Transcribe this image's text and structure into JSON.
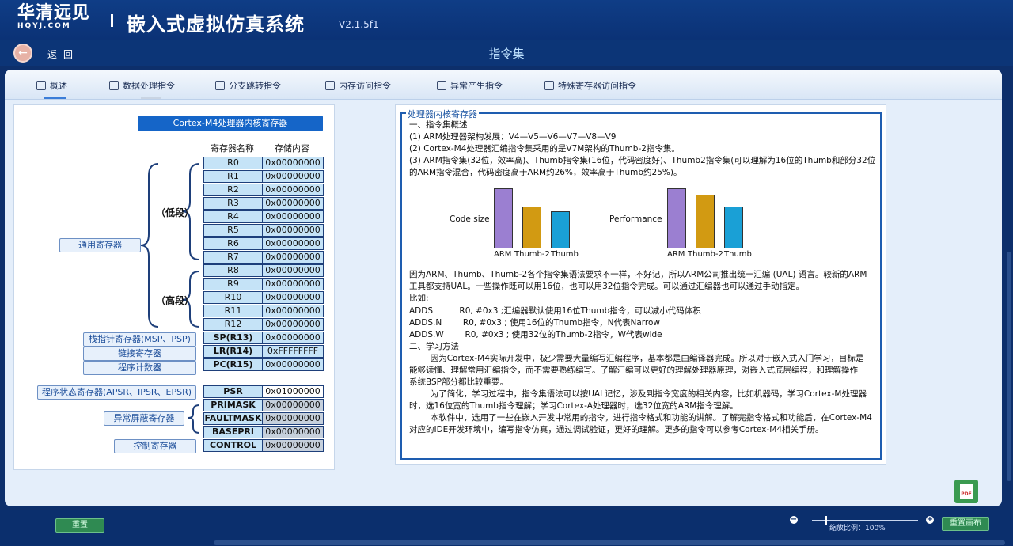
{
  "header": {
    "logo_cn": "华清远见",
    "logo_en": "HQYJ.COM",
    "system_title": "嵌入式虚拟仿真系统",
    "version": "V2.1.5f1"
  },
  "nav": {
    "back_icon": "←",
    "back_label": "返回",
    "page_title": "指令集"
  },
  "tabs": [
    {
      "label": "概述",
      "icon": "document-icon"
    },
    {
      "label": "数据处理指令",
      "icon": "pulse-icon"
    },
    {
      "label": "分支跳转指令",
      "icon": "edit-icon"
    },
    {
      "label": "内存访问指令",
      "icon": "save-icon"
    },
    {
      "label": "异常产生指令",
      "icon": "warning-icon"
    },
    {
      "label": "特殊寄存器访问指令",
      "icon": "server-icon"
    }
  ],
  "diagram": {
    "title": "Cortex-M4处理器内核寄存器",
    "col_name": "寄存器名称",
    "col_value": "存储内容",
    "low_label": "（低段）",
    "high_label": "（高段）",
    "categories": {
      "general": "通用寄存器",
      "sp": "栈指针寄存器(MSP、PSP)",
      "lr": "链接寄存器",
      "pc": "程序计数器",
      "psr": "程序状态寄存器(APSR、IPSR、EPSR)",
      "mask": "异常屏蔽寄存器",
      "control": "控制寄存器"
    },
    "registers": [
      {
        "name": "R0",
        "value": "0x00000000"
      },
      {
        "name": "R1",
        "value": "0x00000000"
      },
      {
        "name": "R2",
        "value": "0x00000000"
      },
      {
        "name": "R3",
        "value": "0x00000000"
      },
      {
        "name": "R4",
        "value": "0x00000000"
      },
      {
        "name": "R5",
        "value": "0x00000000"
      },
      {
        "name": "R6",
        "value": "0x00000000"
      },
      {
        "name": "R7",
        "value": "0x00000000"
      },
      {
        "name": "R8",
        "value": "0x00000000"
      },
      {
        "name": "R9",
        "value": "0x00000000"
      },
      {
        "name": "R10",
        "value": "0x00000000"
      },
      {
        "name": "R11",
        "value": "0x00000000"
      },
      {
        "name": "R12",
        "value": "0x00000000"
      },
      {
        "name": "SP(R13)",
        "value": "0x00000000"
      },
      {
        "name": "LR(R14)",
        "value": "0xFFFFFFFF"
      },
      {
        "name": "PC(R15)",
        "value": "0x00000000"
      }
    ],
    "special": [
      {
        "name": "PSR",
        "value": "0x01000000"
      },
      {
        "name": "PRIMASK",
        "value": "0x00000000"
      },
      {
        "name": "FAULTMASK",
        "value": "0x00000000"
      },
      {
        "name": "BASEPRI",
        "value": "0x00000000"
      },
      {
        "name": "CONTROL",
        "value": "0x00000000"
      }
    ]
  },
  "description": {
    "frame_title": "处理器内核寄存器",
    "lines": [
      "一、指令集概述",
      "(1) ARM处理器架构发展：V4—V5—V6—V7—V8—V9",
      "(2) Cortex-M4处理器汇编指令集采用的是V7M架构的Thumb-2指令集。",
      "(3) ARM指令集(32位，效率高)、Thumb指令集(16位，代码密度好)、Thumb2指令集(可以理解为16位的Thumb和部分32位",
      "的ARM指令混合，代码密度高于ARM约26%，效率高于Thumb约25%)。"
    ],
    "lines2": [
      "因为ARM、Thumb、Thumb-2各个指令集语法要求不一样，不好记，所以ARM公司推出统一汇编 (UAL) 语言。较新的ARM",
      "工具都支持UAL。一些操作既可以用16位，也可以用32位指令完成。可以通过汇编器也可以通过手动指定。",
      "比如:",
      "ADDS          R0, #0x3 ;汇编器默认使用16位Thumb指令，可以减小代码体积",
      "ADDS.N        R0, #0x3 ; 使用16位的Thumb指令，N代表Narrow",
      "ADDS.W        R0, #0x3 ; 使用32位的Thumb-2指令，W代表wide",
      "二、学习方法",
      "        因为Cortex-M4实际开发中，极少需要大量编写汇编程序，基本都是由编译器完成。所以对于嵌入式入门学习，目标是",
      "能够读懂、理解常用汇编指令，而不需要熟练编写。了解汇编可以更好的理解处理器原理，对嵌入式底层编程，和理解操作",
      "系统BSP部分都比较重要。",
      "        为了简化，学习过程中，指令集语法可以按UAL记忆，涉及到指令宽度的相关内容，比如机器码，学习Cortex-M处理器",
      "时，选16位宽的Thumb指令理解；学习Cortex-A处理器时，选32位宽的ARM指令理解。",
      "        本软件中，选用了一些在嵌入开发中常用的指令，进行指令格式和功能的讲解。了解完指令格式和功能后，在Cortex-M4",
      "对应的IDE开发环境中，编写指令仿真，通过调试验证，更好的理解。更多的指令可以参考Cortex-M4相关手册。"
    ]
  },
  "chart_data": [
    {
      "type": "bar",
      "ylabel": "Code size",
      "categories": [
        "ARM",
        "Thumb-2",
        "Thumb"
      ],
      "values": [
        100,
        70,
        62
      ],
      "colors": [
        "#9b7fd1",
        "#d29a12",
        "#1aa0d6"
      ]
    },
    {
      "type": "bar",
      "ylabel": "Performance",
      "categories": [
        "ARM",
        "Thumb-2",
        "Thumb"
      ],
      "values": [
        100,
        90,
        70
      ],
      "colors": [
        "#9b7fd1",
        "#d29a12",
        "#1aa0d6"
      ]
    }
  ],
  "footer": {
    "reset_label": "重置",
    "redraw_label": "重置画布",
    "zoom_text": "缩放比例：100%",
    "zoom_minus": "−",
    "zoom_plus": "+",
    "pdf_label": "PDF"
  }
}
